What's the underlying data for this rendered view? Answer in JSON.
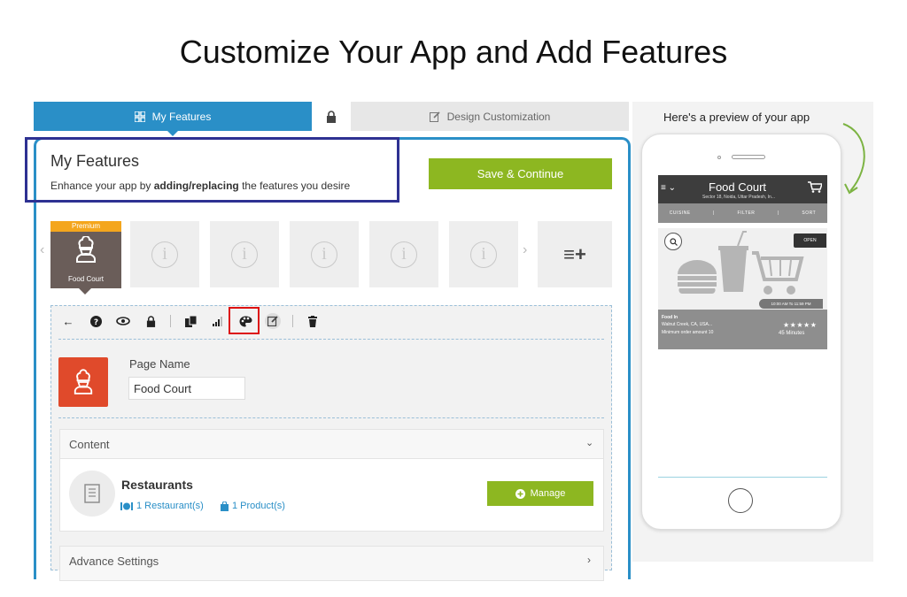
{
  "slide_title": "Customize Your App and Add Features",
  "tabs": {
    "features": {
      "label": "My Features",
      "icon": "grid-icon"
    },
    "lock": {
      "icon": "lock-icon"
    },
    "design": {
      "label": "Design Customization",
      "icon": "edit-icon"
    }
  },
  "header": {
    "title": "My Features",
    "subtitle_pre": "Enhance your app by ",
    "subtitle_bold": "adding/replacing",
    "subtitle_post": " the features you desire",
    "save_label": "Save & Continue"
  },
  "carousel": {
    "active_card": {
      "badge": "Premium",
      "label": "Food Court",
      "icon": "chef-icon"
    },
    "placeholder_icon": "i",
    "add_label": "≡+"
  },
  "toolbar": [
    "back-arrow-icon",
    "help-icon",
    "eye-icon",
    "lock-icon",
    "copy-icon",
    "signal-icon",
    "palette-icon",
    "edit-icon",
    "trash-icon"
  ],
  "page": {
    "name_label": "Page Name",
    "name_value": "Food Court"
  },
  "content": {
    "label": "Content",
    "item_title": "Restaurants",
    "restaurant_count": "1 Restaurant(s)",
    "product_count": "1 Product(s)",
    "manage_label": "Manage"
  },
  "advance": {
    "label": "Advance Settings"
  },
  "preview": {
    "caption": "Here's a preview of your app",
    "app_title": "Food Court",
    "address": "Sector 18, Noida, Uttar Pradesh, In...",
    "filters": [
      "CUISINE",
      "FILTER",
      "SORT"
    ],
    "open_label": "OPEN",
    "hours": "10:00 AM To 11:59 PM",
    "rest_name": "Food In",
    "rest_address": "Walnut Creek, CA, USA...",
    "rest_min_order": "Minimum order amount 10",
    "stars": "★★★★★",
    "delivery_time": "45 Minutes"
  },
  "colors": {
    "accent": "#2a8fc7",
    "green": "#8db721",
    "highlight": "#2e3192",
    "red": "#dd1111",
    "page_icon": "#e04a2b"
  }
}
